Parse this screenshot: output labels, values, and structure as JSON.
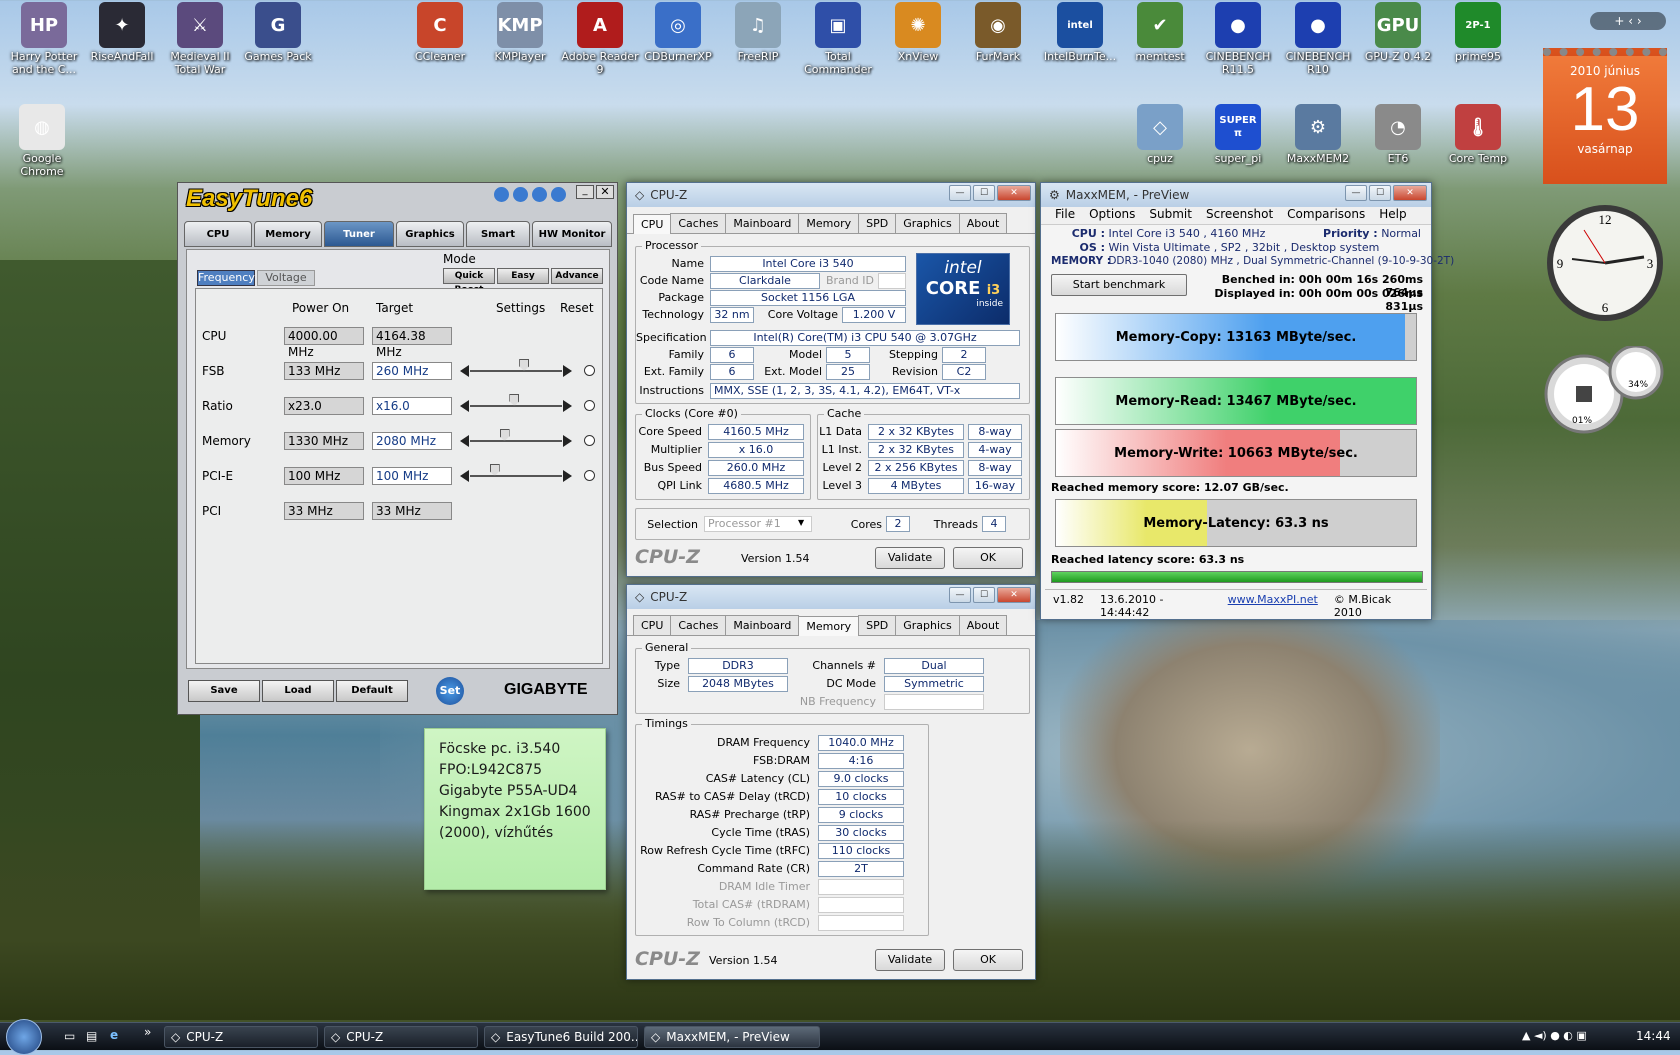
{
  "desktop": {
    "icons": [
      {
        "label": "Harry Potter and the C...",
        "color": "#7a6a9a",
        "glyph": "HP"
      },
      {
        "label": "RiseAndFall",
        "color": "#2a2a35",
        "glyph": "✦"
      },
      {
        "label": "Medieval II Total War",
        "color": "#5b4a7d",
        "glyph": "⚔"
      },
      {
        "label": "Games Pack",
        "color": "#3a4e8c",
        "glyph": "G"
      },
      {
        "label": "CCleaner",
        "color": "#c8452a",
        "glyph": "C"
      },
      {
        "label": "KMPlayer",
        "color": "#7e8fa8",
        "glyph": "KMP"
      },
      {
        "label": "Adobe Reader 9",
        "color": "#b01c1c",
        "glyph": "A"
      },
      {
        "label": "CDBurnerXP",
        "color": "#3a6fc8",
        "glyph": "◎"
      },
      {
        "label": "FreeRIP",
        "color": "#8ca5b8",
        "glyph": "♫"
      },
      {
        "label": "Total Commander",
        "color": "#2f4fa8",
        "glyph": "▣"
      },
      {
        "label": "XnView",
        "color": "#d98a20",
        "glyph": "✺"
      },
      {
        "label": "FurMark",
        "color": "#7a5a2a",
        "glyph": "◉"
      },
      {
        "label": "IntelBurnTe...",
        "color": "#1b4fa0",
        "glyph": "intel"
      },
      {
        "label": "memtest",
        "color": "#4a8a3a",
        "glyph": "✔"
      },
      {
        "label": "CINEBENCH R11.5",
        "color": "#1d3fb0",
        "glyph": "●"
      },
      {
        "label": "CINEBENCH R10",
        "color": "#1d3fb0",
        "glyph": "●"
      },
      {
        "label": "GPU-Z 0.4.2",
        "color": "#4a8a4a",
        "glyph": "GPU"
      },
      {
        "label": "prime95",
        "color": "#1f8a2a",
        "glyph": "2P-1"
      },
      {
        "label": "Google Chrome",
        "color": "#e8e8e8",
        "glyph": "◍"
      },
      {
        "label": "cpuz",
        "color": "#7aa0c8",
        "glyph": "◇"
      },
      {
        "label": "super_pi",
        "color": "#1e4fd0",
        "glyph": "SUPER π"
      },
      {
        "label": "MaxxMEM2",
        "color": "#5a7aa0",
        "glyph": "⚙"
      },
      {
        "label": "ET6",
        "color": "#8a8a8a",
        "glyph": "◔"
      },
      {
        "label": "Core Temp",
        "color": "#c04040",
        "glyph": "🌡"
      }
    ],
    "calendar": {
      "month": "2010 június",
      "day": "13",
      "weekday": "vasárnap"
    },
    "gauge": {
      "left": "01%",
      "right": "34%"
    }
  },
  "easytune": {
    "title": "EasyTune6",
    "tabs": [
      "CPU",
      "Memory",
      "Tuner",
      "Graphics",
      "Smart",
      "HW Monitor"
    ],
    "subtabs": [
      "Frequency",
      "Voltage"
    ],
    "mode_label": "Mode",
    "modes": [
      "Quick Boost",
      "Easy",
      "Advance"
    ],
    "headers": {
      "power_on": "Power On",
      "target": "Target",
      "settings": "Settings",
      "reset": "Reset"
    },
    "rows": [
      {
        "label": "CPU",
        "power_on": "4000.00 MHz",
        "target": "4164.38 MHz",
        "slider": null
      },
      {
        "label": "FSB",
        "power_on": "133 MHz",
        "target": "260 MHz",
        "slider": 0.6
      },
      {
        "label": "Ratio",
        "power_on": "x23.0",
        "target": "x16.0",
        "slider": 0.48
      },
      {
        "label": "Memory",
        "power_on": "1330 MHz",
        "target": "2080 MHz",
        "slider": 0.36
      },
      {
        "label": "PCI-E",
        "power_on": "100 MHz",
        "target": "100 MHz",
        "slider": 0.24
      },
      {
        "label": "PCI",
        "power_on": "33 MHz",
        "target": "33 MHz",
        "slider": null
      }
    ],
    "footer": {
      "save": "Save",
      "load": "Load",
      "default": "Default",
      "set": "Set",
      "brand": "GIGABYTE"
    }
  },
  "cpuz1": {
    "title": "CPU-Z",
    "tabs": [
      "CPU",
      "Caches",
      "Mainboard",
      "Memory",
      "SPD",
      "Graphics",
      "About"
    ],
    "processor": {
      "group": "Processor",
      "name_l": "Name",
      "name": "Intel Core i3 540",
      "code_l": "Code Name",
      "code": "Clarkdale",
      "brand_l": "Brand ID",
      "pkg_l": "Package",
      "pkg": "Socket 1156 LGA",
      "tech_l": "Technology",
      "tech": "32 nm",
      "cv_l": "Core Voltage",
      "cv": "1.200 V",
      "spec_l": "Specification",
      "spec": "Intel(R) Core(TM) i3 CPU        540  @ 3.07GHz",
      "fam_l": "Family",
      "fam": "6",
      "model_l": "Model",
      "model": "5",
      "step_l": "Stepping",
      "step": "2",
      "efam_l": "Ext. Family",
      "efam": "6",
      "emodel_l": "Ext. Model",
      "emodel": "25",
      "rev_l": "Revision",
      "rev": "C2",
      "inst_l": "Instructions",
      "inst": "MMX, SSE (1, 2, 3, 3S, 4.1, 4.2), EM64T, VT-x",
      "logo_brand": "intel",
      "logo_core": "CORE",
      "logo_gen": "i3",
      "logo_inside": "inside"
    },
    "clocks": {
      "group": "Clocks (Core #0)",
      "cs_l": "Core Speed",
      "cs": "4160.5 MHz",
      "mul_l": "Multiplier",
      "mul": "x 16.0",
      "bus_l": "Bus Speed",
      "bus": "260.0 MHz",
      "qpi_l": "QPI Link",
      "qpi": "4680.5 MHz"
    },
    "cache": {
      "group": "Cache",
      "l1d_l": "L1 Data",
      "l1d": "2 x 32 KBytes",
      "l1d_w": "8-way",
      "l1i_l": "L1 Inst.",
      "l1i": "2 x 32 KBytes",
      "l1i_w": "4-way",
      "l2_l": "Level 2",
      "l2": "2 x 256 KBytes",
      "l2_w": "8-way",
      "l3_l": "Level 3",
      "l3": "4 MBytes",
      "l3_w": "16-way"
    },
    "sel": {
      "sel_l": "Selection",
      "sel": "Processor #1",
      "cores_l": "Cores",
      "cores": "2",
      "threads_l": "Threads",
      "threads": "4"
    },
    "footer": {
      "logo": "CPU-Z",
      "version": "Version 1.54",
      "validate": "Validate",
      "ok": "OK"
    }
  },
  "cpuz2": {
    "title": "CPU-Z",
    "tabs": [
      "CPU",
      "Caches",
      "Mainboard",
      "Memory",
      "SPD",
      "Graphics",
      "About"
    ],
    "general": {
      "group": "General",
      "type_l": "Type",
      "type": "DDR3",
      "size_l": "Size",
      "size": "2048 MBytes",
      "ch_l": "Channels #",
      "ch": "Dual",
      "dc_l": "DC Mode",
      "dc": "Symmetric",
      "nb_l": "NB Frequency"
    },
    "timings": {
      "group": "Timings",
      "rows": [
        {
          "l": "DRAM Frequency",
          "v": "1040.0 MHz",
          "dim": false
        },
        {
          "l": "FSB:DRAM",
          "v": "4:16",
          "dim": false
        },
        {
          "l": "CAS# Latency (CL)",
          "v": "9.0 clocks",
          "dim": false
        },
        {
          "l": "RAS# to CAS# Delay (tRCD)",
          "v": "10 clocks",
          "dim": false
        },
        {
          "l": "RAS# Precharge (tRP)",
          "v": "9 clocks",
          "dim": false
        },
        {
          "l": "Cycle Time (tRAS)",
          "v": "30 clocks",
          "dim": false
        },
        {
          "l": "Row Refresh Cycle Time (tRFC)",
          "v": "110 clocks",
          "dim": false
        },
        {
          "l": "Command Rate (CR)",
          "v": "2T",
          "dim": false
        },
        {
          "l": "DRAM Idle Timer",
          "v": "",
          "dim": true
        },
        {
          "l": "Total CAS# (tRDRAM)",
          "v": "",
          "dim": true
        },
        {
          "l": "Row To Column (tRCD)",
          "v": "",
          "dim": true
        }
      ]
    },
    "footer": {
      "logo": "CPU-Z",
      "version": "Version 1.54",
      "validate": "Validate",
      "ok": "OK"
    }
  },
  "maxxmem": {
    "title": "MaxxMEM, - PreView",
    "menu": [
      "File",
      "Options",
      "Submit",
      "Screenshot",
      "Comparisons",
      "Help"
    ],
    "cpu_l": "CPU :",
    "cpu": "Intel Core i3 540 , 4160 MHz",
    "prio_l": "Priority :",
    "prio": "Normal",
    "os_l": "OS :",
    "os": "Win Vista Ultimate , SP2 , 32bit , Desktop system",
    "mem_l": "MEMORY :",
    "mem": "DDR3-1040 (2080) MHz , Dual Symmetric-Channel (9-10-9-30-2T)",
    "start": "Start benchmark",
    "benched": "Benched in: 00h 00m 16s 260ms 764µs",
    "displayed": "Displayed in: 00h 00m 00s 026ms 831µs",
    "copy": {
      "text": "Memory-Copy: 13163 MByte/sec.",
      "fill": 0.97,
      "color": "#4ea0ef"
    },
    "read": {
      "text": "Memory-Read: 13467 MByte/sec.",
      "fill": 1.0,
      "color": "#3fd16a"
    },
    "write": {
      "text": "Memory-Write: 10663 MByte/sec.",
      "fill": 0.79,
      "color": "#f07e7e"
    },
    "score": "Reached memory score: 12.07 GB/sec.",
    "latency": {
      "text": "Memory-Latency: 63.3 ns",
      "fill": 0.42,
      "color": "#e8e86a"
    },
    "lat_score": "Reached latency score: 63.3 ns",
    "status": {
      "ver": "v1.82",
      "date": "13.6.2010 - 14:44:42",
      "url": "www.MaxxPI.net",
      "copy": "© M.Bicak 2010"
    }
  },
  "note": {
    "text": "Föcske pc. i3.540\nFPO:L942C875\nGigabyte P55A-UD4\nKingmax  2x1Gb 1600 (2000), vízhűtés"
  },
  "taskbar": {
    "items": [
      "CPU-Z",
      "CPU-Z",
      "EasyTune6 Build 200...",
      "MaxxMEM, - PreView"
    ],
    "time": "14:44",
    "more": "»"
  }
}
